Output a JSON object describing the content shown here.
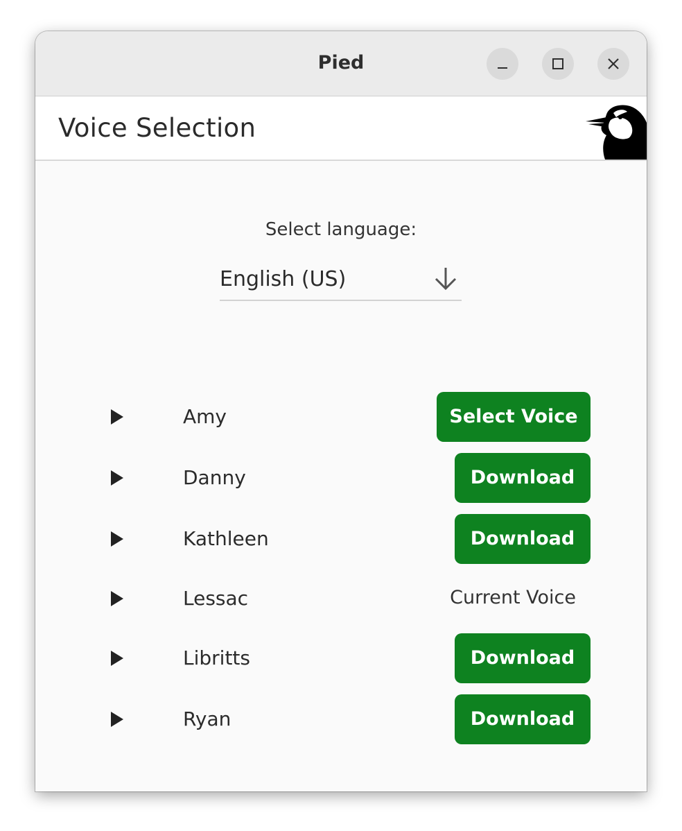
{
  "window": {
    "title": "Pied"
  },
  "header": {
    "title": "Voice Selection"
  },
  "language": {
    "label": "Select language:",
    "selected": "English (US)"
  },
  "voices": [
    {
      "name": "Amy",
      "action": "Select Voice"
    },
    {
      "name": "Danny",
      "action": "Download"
    },
    {
      "name": "Kathleen",
      "action": "Download"
    },
    {
      "name": "Lessac",
      "status": "Current Voice"
    },
    {
      "name": "Libritts",
      "action": "Download"
    },
    {
      "name": "Ryan",
      "action": "Download"
    }
  ],
  "colors": {
    "button_green": "#0e8220",
    "titlebar": "#ebebeb",
    "background": "#fafafa"
  },
  "icons": {
    "minimize": "minimize-icon",
    "maximize": "maximize-icon",
    "close": "close-icon",
    "play": "play-icon",
    "dropdown": "arrow-down-icon",
    "logo": "wagtail-bird-logo"
  }
}
